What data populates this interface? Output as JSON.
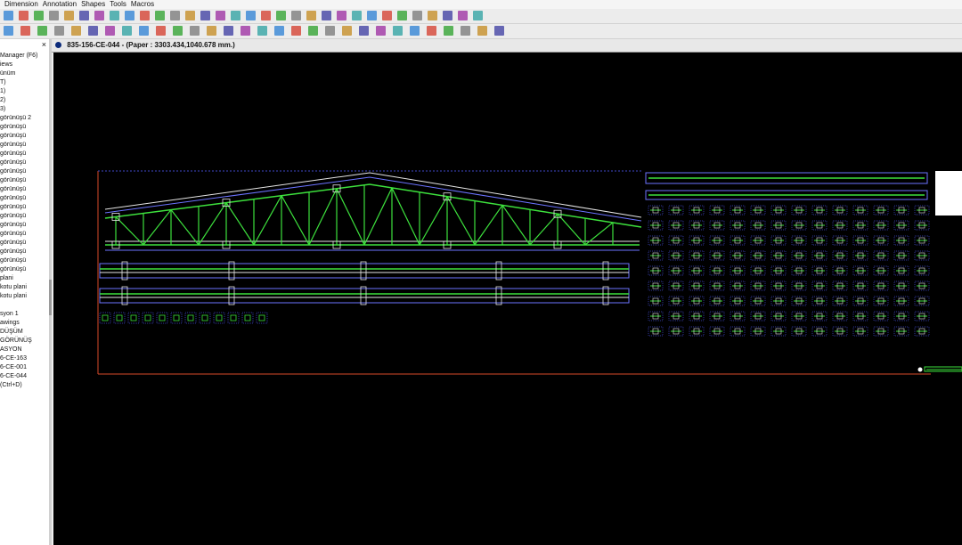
{
  "menu": {
    "items": [
      "Dimension",
      "Annotation",
      "Shapes",
      "Tools",
      "Macros"
    ]
  },
  "toolbar1": {
    "icons": [
      "open-icon",
      "save-icon",
      "print-icon",
      "copy-icon",
      "paste-icon",
      "settings-icon",
      "edit-icon",
      "play-icon",
      "play-all-icon",
      "stop-icon",
      "layers-icon",
      "grid-icon",
      "zoom-icon",
      "filter-icon",
      "delete-icon",
      "rotate-icon",
      "mirror-icon",
      "line-icon",
      "list-icon",
      "refresh-icon",
      "arrow-icon",
      "vector-icon",
      "magnet-icon",
      "select-icon",
      "hatch-icon",
      "circle-icon",
      "rectangle-icon",
      "polygon-icon",
      "bolt-icon",
      "tag-icon",
      "block-icon",
      "insert-icon"
    ]
  },
  "toolbar2": {
    "icons": [
      "circle-icon",
      "ellipse-icon",
      "oval-icon",
      "text-icon",
      "pencil-icon",
      "cross-icon",
      "trim-icon",
      "extend-icon",
      "fillet-icon",
      "search-icon",
      "frame-icon",
      "measure-icon",
      "dimension-icon",
      "weld-icon",
      "arc-icon",
      "flash-icon",
      "spline-icon",
      "tank-icon",
      "globe-icon",
      "cup-icon",
      "label-icon",
      "leader-icon",
      "note-icon",
      "marker-icon",
      "section-icon",
      "detail-icon",
      "title-icon",
      "format-icon",
      "scale-icon",
      "export-icon"
    ]
  },
  "leftPanel": {
    "items": [
      "Manager (F6)",
      "iews",
      "ünüm",
      "T)",
      "1)",
      "2)",
      "3)",
      "görünüşü 2",
      "görünüşü",
      "görünüşü",
      "görünüşü",
      "görünüşü",
      "görünüşü",
      "görünüşü",
      "görünüşü",
      "görünüşü",
      "görünüşü",
      "görünüşü",
      "görünüşü",
      "görünüşü",
      "görünüşü",
      "görünüşü",
      "görünüşü",
      "görünüşü",
      "görünüşü",
      "plani",
      "kotu plani",
      "kotu plani",
      "",
      "syon 1",
      "awings",
      "DÜŞÜM",
      "GÖRÜNÜŞ",
      "ASYON",
      "6-CE-163",
      "6-CE-001",
      "6-CE-044",
      "(Ctrl+D)"
    ]
  },
  "document": {
    "tab_title": "835-156-CE-044 - (Paper : 3303.434,1040.678 mm.)"
  },
  "colors": {
    "canvas": "#000000",
    "steel_green": "#3de13d",
    "outline_white": "#e6e6e6",
    "outline_blue": "#6b73ff",
    "frame_red": "#d84a2a",
    "dotted_blue": "#3f48c8"
  }
}
